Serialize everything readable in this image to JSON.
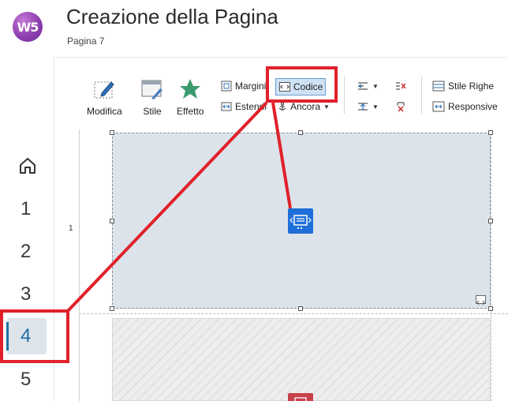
{
  "app": {
    "logo_text": "W5",
    "title": "Creazione della Pagina",
    "subtitle": "Pagina 7"
  },
  "sidebar": {
    "steps": [
      {
        "label": "1",
        "active": false
      },
      {
        "label": "2",
        "active": false
      },
      {
        "label": "3",
        "active": false
      },
      {
        "label": "4",
        "active": true
      },
      {
        "label": "5",
        "active": false
      }
    ]
  },
  "toolbar": {
    "modifica": "Modifica",
    "stile": "Stile",
    "effetto": "Effetto",
    "margini": "Margini",
    "estendi": "Estendi",
    "codice": "Codice",
    "ancora": "Ancora",
    "stile_righe": "Stile Righe",
    "responsive": "Responsive"
  },
  "canvas": {
    "row_number": "1"
  },
  "colors": {
    "accent": "#1f6fa5",
    "annotation": "#e0212b",
    "code_object": "#1e6fd9",
    "selected_button": "#cfe2f5"
  }
}
